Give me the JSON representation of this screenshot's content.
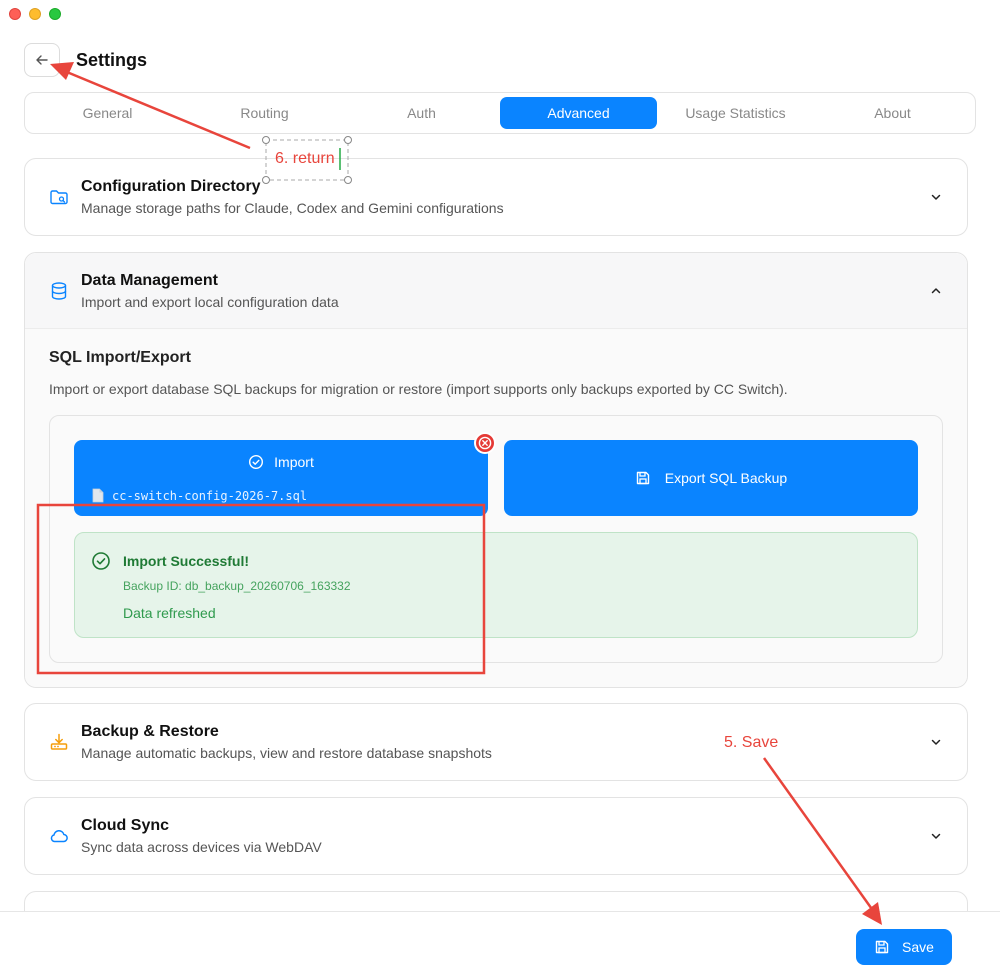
{
  "window": {
    "title": "Settings"
  },
  "tabs": [
    {
      "label": "General"
    },
    {
      "label": "Routing"
    },
    {
      "label": "Auth"
    },
    {
      "label": "Advanced"
    },
    {
      "label": "Usage Statistics"
    },
    {
      "label": "About"
    }
  ],
  "sections": {
    "config_dir": {
      "title": "Configuration Directory",
      "desc": "Manage storage paths for Claude, Codex and Gemini configurations"
    },
    "data_mgmt": {
      "title": "Data Management",
      "desc": "Import and export local configuration data"
    },
    "backup": {
      "title": "Backup & Restore",
      "desc": "Manage automatic backups, view and restore database snapshots"
    },
    "cloud": {
      "title": "Cloud Sync",
      "desc": "Sync data across devices via WebDAV"
    }
  },
  "sql": {
    "title": "SQL Import/Export",
    "desc": "Import or export database SQL backups for migration or restore (import supports only backups exported by CC Switch).",
    "import_label": "Import",
    "import_file": "cc-switch-config-2026-7.sql",
    "export_label": "Export SQL Backup"
  },
  "success": {
    "title": "Import Successful!",
    "backup_id": "Backup ID: db_backup_20260706_163332",
    "note": "Data refreshed"
  },
  "footer": {
    "save_label": "Save"
  },
  "annotations": {
    "return_label": "6. return",
    "save_label": "5. Save"
  },
  "colors": {
    "accent": "#0a84ff",
    "success_bg": "#e6f4ea",
    "success_text": "#1f7a35",
    "annotation": "#e8453c"
  },
  "icons": {
    "back": "arrow-left-icon",
    "config_dir": "folder-search-icon",
    "data_mgmt": "database-icon",
    "backup": "download-tray-icon",
    "cloud": "cloud-icon",
    "save": "floppy-disk-icon"
  }
}
